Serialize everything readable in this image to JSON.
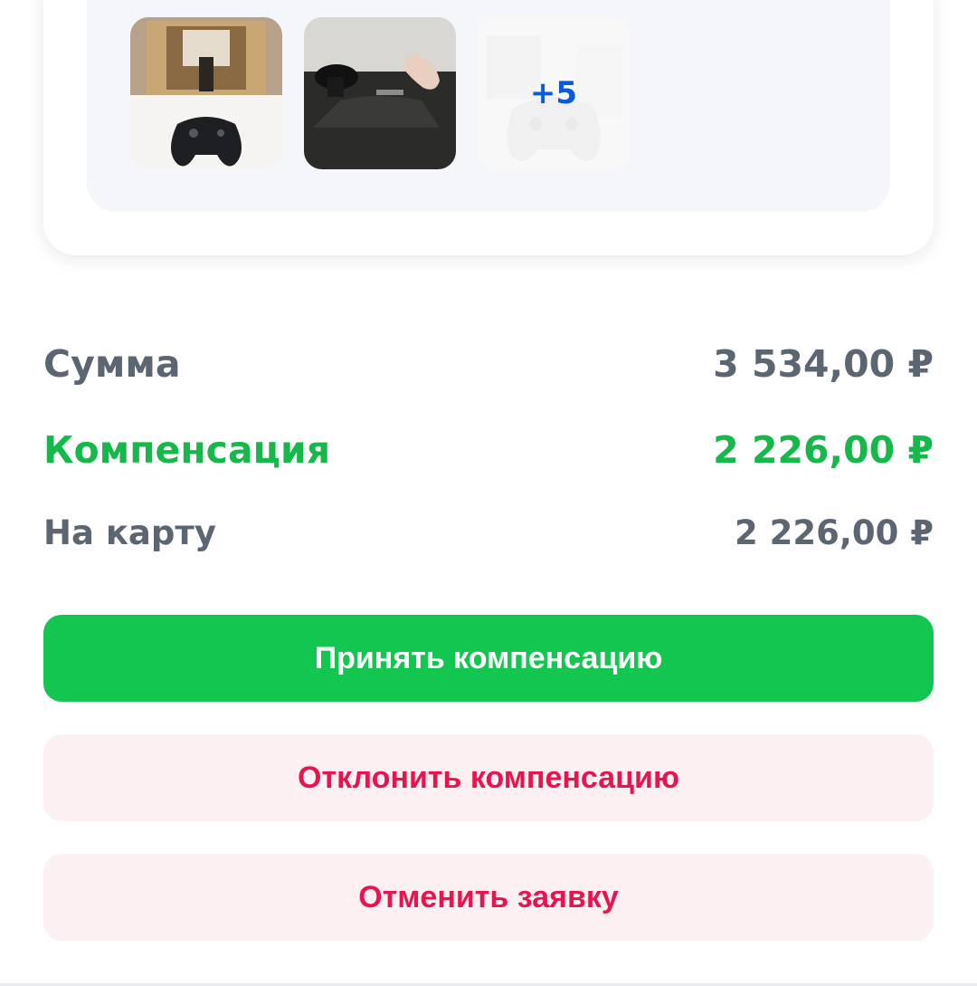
{
  "gallery": {
    "more_count": "+5",
    "photos": [
      {
        "icon": "gamepad-box-photo"
      },
      {
        "icon": "gamepad-stick-photo"
      },
      {
        "icon": "gamepad-white-photo"
      }
    ]
  },
  "summary": {
    "sum_label": "Сумма",
    "sum_value": "3 534,00 ₽",
    "compensation_label": "Компенсация",
    "compensation_value": "2 226,00 ₽",
    "to_card_label": "На карту",
    "to_card_value": "2 226,00 ₽"
  },
  "actions": {
    "accept_label": "Принять компенсацию",
    "decline_label": "Отклонить компенсацию",
    "cancel_label": "Отменить заявку"
  },
  "colors": {
    "accent_green": "#13c650",
    "danger_pink": "#e6154f",
    "muted_text": "#5c6673",
    "link_blue": "#0b5bd8"
  }
}
